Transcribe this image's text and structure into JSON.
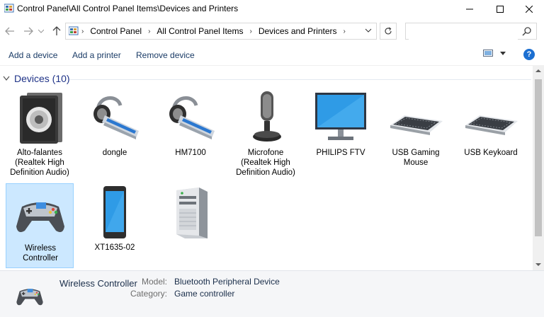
{
  "window": {
    "title": "Control Panel\\All Control Panel Items\\Devices and Printers"
  },
  "address": {
    "crumbs": [
      "Control Panel",
      "All Control Panel Items",
      "Devices and Printers"
    ]
  },
  "search": {
    "placeholder": ""
  },
  "commands": {
    "add_device": "Add a device",
    "add_printer": "Add a printer",
    "remove_device": "Remove device",
    "help": "?"
  },
  "group": {
    "title": "Devices (10)"
  },
  "devices": [
    {
      "label": "Alto-falantes\n(Realtek High\nDefinition Audio)",
      "icon": "speaker-icon"
    },
    {
      "label": "dongle",
      "icon": "headset-icon"
    },
    {
      "label": "HM7100",
      "icon": "headset-icon"
    },
    {
      "label": "Microfone\n(Realtek High\nDefinition Audio)",
      "icon": "microphone-icon"
    },
    {
      "label": "PHILIPS FTV",
      "icon": "monitor-icon"
    },
    {
      "label": "USB Gaming\nMouse",
      "icon": "keyboard-icon"
    },
    {
      "label": "USB Keykoard",
      "icon": "keyboard-icon"
    },
    {
      "label": "Wireless\nController",
      "icon": "gamepad-icon"
    },
    {
      "label": "XT1635-02",
      "icon": "smartphone-icon"
    },
    {
      "label": "",
      "icon": "computer-tower-icon"
    }
  ],
  "details": {
    "name": "Wireless Controller",
    "model_label": "Model:",
    "model_value": "Bluetooth Peripheral Device",
    "category_label": "Category:",
    "category_value": "Game controller"
  },
  "colors": {
    "accent": "#1e3287",
    "selection": "#cce8ff",
    "help": "#1c6fd1"
  }
}
